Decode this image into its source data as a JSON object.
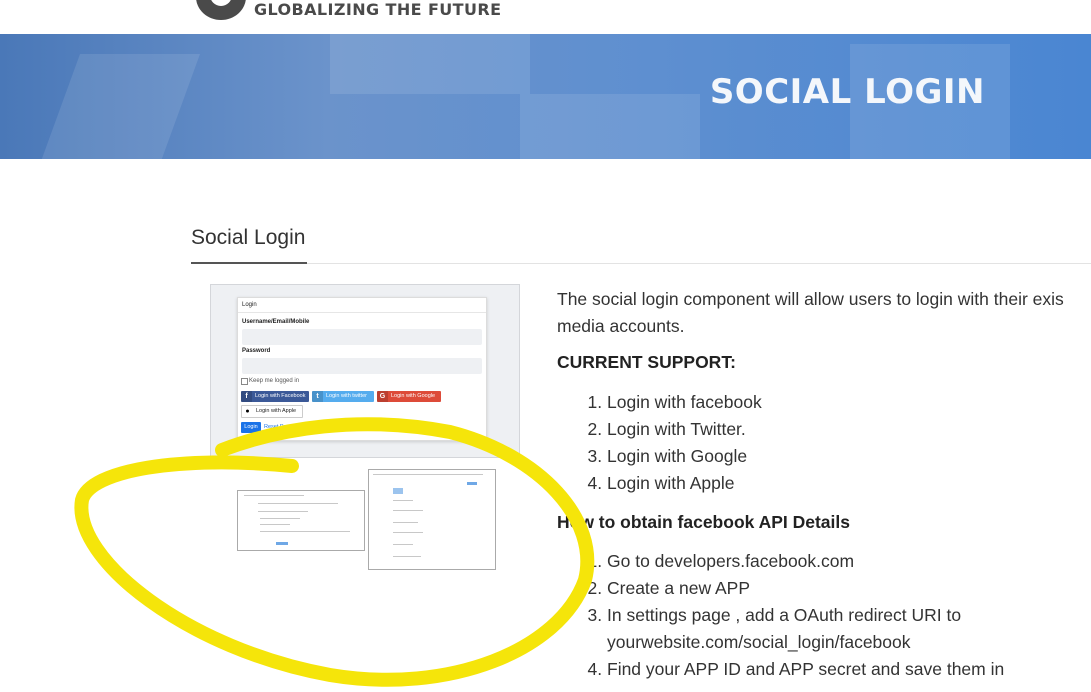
{
  "header": {
    "tagline": "GLOBALIZING THE FUTURE"
  },
  "banner": {
    "title": "SOCIAL LOGIN"
  },
  "section": {
    "title": "Social Login"
  },
  "preview": {
    "card_title": "Login",
    "username_label": "Username/Email/Mobile",
    "password_label": "Password",
    "keep_logged_in": "Keep me logged in",
    "buttons": {
      "facebook": "Login with Facebook",
      "twitter": "Login with twitter",
      "google": "Login with Google",
      "apple": "Login with Apple",
      "login": "Login",
      "reset": "Reset Password"
    }
  },
  "content": {
    "description_line1": "The social login component will allow users to login with their exis",
    "description_line2": "media accounts.",
    "current_support_heading": "CURRENT SUPPORT:",
    "support_items": [
      "Login with facebook",
      "Login with Twitter.",
      "Login with Google",
      "Login with Apple"
    ],
    "facebook_heading": "How to obtain facebook API Details",
    "facebook_steps": [
      "Go to developers.facebook.com",
      "Create a new APP",
      "In settings page , add a OAuth redirect URI to",
      "yourwebsite.com/social_login/facebook",
      "Find your APP ID and APP secret and save them in"
    ]
  },
  "colors": {
    "banner": "#5e8fd0",
    "highlight": "#f5e50a",
    "facebook": "#3b5998",
    "twitter": "#55acee",
    "google": "#dd4b39",
    "login": "#1a73e8"
  }
}
